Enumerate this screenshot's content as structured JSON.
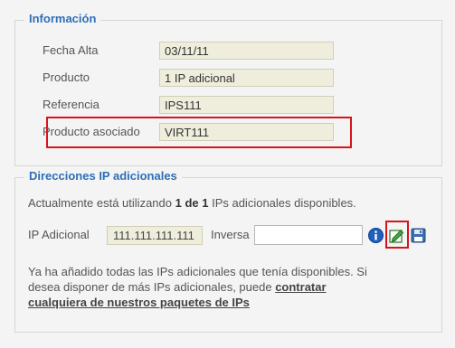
{
  "info_section": {
    "legend": "Información",
    "fields": [
      {
        "label": "Fecha Alta",
        "value": "03/11/11"
      },
      {
        "label": "Producto",
        "value": "1 IP adicional"
      },
      {
        "label": "Referencia",
        "value": "IPS111"
      },
      {
        "label": "Producto asociado",
        "value": "VIRT111"
      }
    ]
  },
  "ip_section": {
    "legend": "Direcciones IP adicionales",
    "status_prefix": "Actualmente está utilizando ",
    "status_count": "1 de 1",
    "status_suffix": " IPs adicionales disponibles.",
    "ip_label": "IP Adicional",
    "ip_value": "111.111.111.111",
    "inverse_label": "Inversa",
    "inverse_value": "",
    "message_text": "Ya ha añadido todas las IPs adicionales que tenía disponibles. Si desea disponer de más IPs adicionales, puede ",
    "message_link": "contratar cualquiera de nuestros paquetes de IPs"
  },
  "colors": {
    "legend": "#2f6fb6",
    "highlight": "#d8141b",
    "readonly_bg": "#efeedc"
  },
  "icons": [
    "info-icon",
    "edit-icon",
    "save-icon"
  ]
}
